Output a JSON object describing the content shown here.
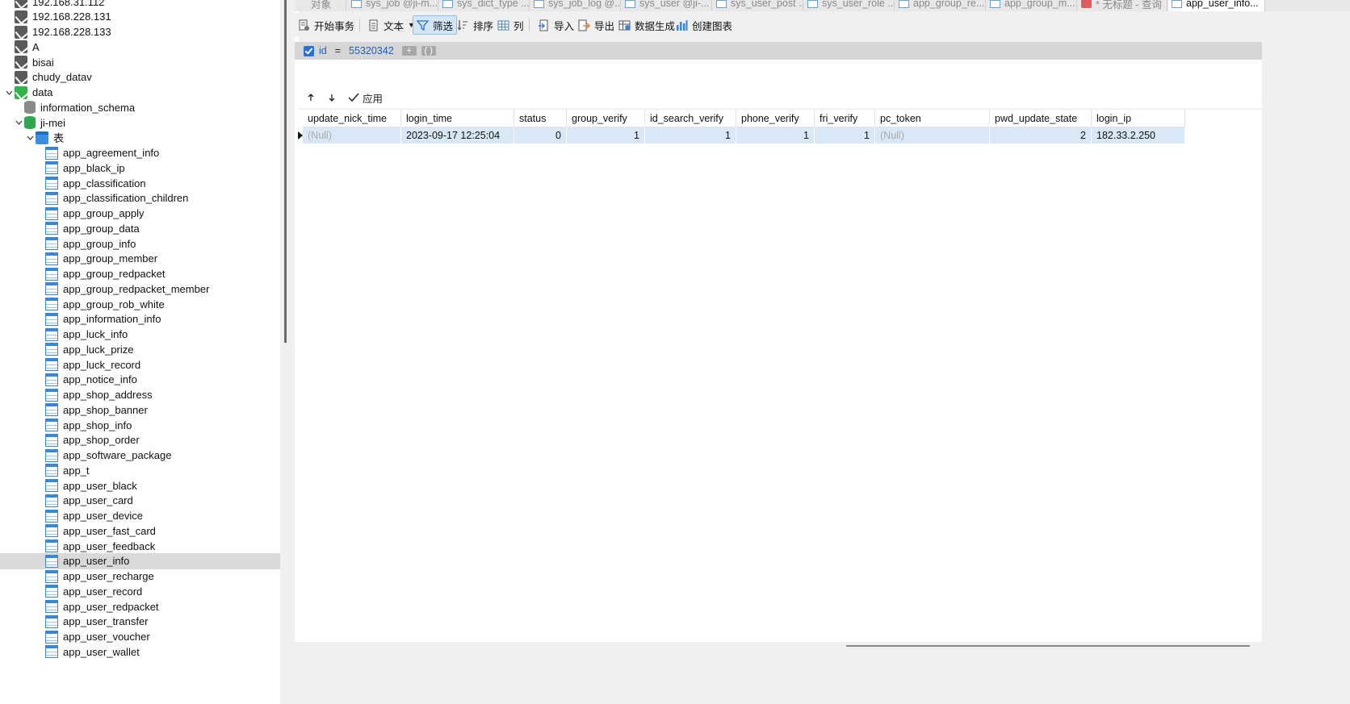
{
  "sidebar": {
    "items": [
      {
        "label": "192.168.31.112",
        "icon": "connection-icon",
        "level": 1,
        "chev": ""
      },
      {
        "label": "192.168.228.131",
        "icon": "connection-icon",
        "level": 1,
        "chev": ""
      },
      {
        "label": "192.168.228.133",
        "icon": "connection-icon",
        "level": 1,
        "chev": ""
      },
      {
        "label": "A",
        "icon": "connection-icon",
        "level": 1,
        "chev": ""
      },
      {
        "label": "bisai",
        "icon": "connection-icon",
        "level": 1,
        "chev": ""
      },
      {
        "label": "chudy_datav",
        "icon": "connection-icon",
        "level": 1,
        "chev": ""
      },
      {
        "label": "data",
        "icon": "connection-green-icon",
        "level": 1,
        "chev": "v"
      },
      {
        "label": "information_schema",
        "icon": "database-icon",
        "level": 2,
        "chev": ""
      },
      {
        "label": "ji-mei",
        "icon": "database-green-icon",
        "level": 2,
        "chev": "v"
      },
      {
        "label": "表",
        "icon": "folder-icon",
        "level": 3,
        "chev": "v"
      },
      {
        "label": "app_agreement_info",
        "icon": "table-icon",
        "level": 4,
        "chev": ""
      },
      {
        "label": "app_black_ip",
        "icon": "table-icon",
        "level": 4,
        "chev": ""
      },
      {
        "label": "app_classification",
        "icon": "table-icon",
        "level": 4,
        "chev": ""
      },
      {
        "label": "app_classification_children",
        "icon": "table-icon",
        "level": 4,
        "chev": ""
      },
      {
        "label": "app_group_apply",
        "icon": "table-icon",
        "level": 4,
        "chev": ""
      },
      {
        "label": "app_group_data",
        "icon": "table-icon",
        "level": 4,
        "chev": ""
      },
      {
        "label": "app_group_info",
        "icon": "table-icon",
        "level": 4,
        "chev": ""
      },
      {
        "label": "app_group_member",
        "icon": "table-icon",
        "level": 4,
        "chev": ""
      },
      {
        "label": "app_group_redpacket",
        "icon": "table-icon",
        "level": 4,
        "chev": ""
      },
      {
        "label": "app_group_redpacket_member",
        "icon": "table-icon",
        "level": 4,
        "chev": ""
      },
      {
        "label": "app_group_rob_white",
        "icon": "table-icon",
        "level": 4,
        "chev": ""
      },
      {
        "label": "app_information_info",
        "icon": "table-icon",
        "level": 4,
        "chev": ""
      },
      {
        "label": "app_luck_info",
        "icon": "table-icon",
        "level": 4,
        "chev": ""
      },
      {
        "label": "app_luck_prize",
        "icon": "table-icon",
        "level": 4,
        "chev": ""
      },
      {
        "label": "app_luck_record",
        "icon": "table-icon",
        "level": 4,
        "chev": ""
      },
      {
        "label": "app_notice_info",
        "icon": "table-icon",
        "level": 4,
        "chev": ""
      },
      {
        "label": "app_shop_address",
        "icon": "table-icon",
        "level": 4,
        "chev": ""
      },
      {
        "label": "app_shop_banner",
        "icon": "table-icon",
        "level": 4,
        "chev": ""
      },
      {
        "label": "app_shop_info",
        "icon": "table-icon",
        "level": 4,
        "chev": ""
      },
      {
        "label": "app_shop_order",
        "icon": "table-icon",
        "level": 4,
        "chev": ""
      },
      {
        "label": "app_software_package",
        "icon": "table-icon",
        "level": 4,
        "chev": ""
      },
      {
        "label": "app_t",
        "icon": "table-icon",
        "level": 4,
        "chev": ""
      },
      {
        "label": "app_user_black",
        "icon": "table-icon",
        "level": 4,
        "chev": ""
      },
      {
        "label": "app_user_card",
        "icon": "table-icon",
        "level": 4,
        "chev": ""
      },
      {
        "label": "app_user_device",
        "icon": "table-icon",
        "level": 4,
        "chev": ""
      },
      {
        "label": "app_user_fast_card",
        "icon": "table-icon",
        "level": 4,
        "chev": ""
      },
      {
        "label": "app_user_feedback",
        "icon": "table-icon",
        "level": 4,
        "chev": ""
      },
      {
        "label": "app_user_info",
        "icon": "table-icon",
        "level": 4,
        "chev": "",
        "selected": true
      },
      {
        "label": "app_user_recharge",
        "icon": "table-icon",
        "level": 4,
        "chev": ""
      },
      {
        "label": "app_user_record",
        "icon": "table-icon",
        "level": 4,
        "chev": ""
      },
      {
        "label": "app_user_redpacket",
        "icon": "table-icon",
        "level": 4,
        "chev": ""
      },
      {
        "label": "app_user_transfer",
        "icon": "table-icon",
        "level": 4,
        "chev": ""
      },
      {
        "label": "app_user_voucher",
        "icon": "table-icon",
        "level": 4,
        "chev": ""
      },
      {
        "label": "app_user_wallet",
        "icon": "table-icon",
        "level": 4,
        "chev": ""
      }
    ]
  },
  "tabs": [
    {
      "label": "对象",
      "icon": ""
    },
    {
      "label": "sys_job @ji-m...",
      "icon": "table-icon"
    },
    {
      "label": "sys_dict_type ...",
      "icon": "table-icon"
    },
    {
      "label": "sys_job_log @...",
      "icon": "table-icon"
    },
    {
      "label": "sys_user @ji-...",
      "icon": "table-icon"
    },
    {
      "label": "sys_user_post ...",
      "icon": "table-icon"
    },
    {
      "label": "sys_user_role ...",
      "icon": "table-icon"
    },
    {
      "label": "app_group_re...",
      "icon": "table-icon"
    },
    {
      "label": "app_group_m...",
      "icon": "table-icon"
    },
    {
      "label": "* 无标题 - 查询",
      "icon": "query-icon"
    },
    {
      "label": "app_user_info...",
      "icon": "table-icon",
      "active": true
    }
  ],
  "toolbar": {
    "begin_transaction": "开始事务",
    "text": "文本",
    "filter": "筛选",
    "sort": "排序",
    "columns": "列",
    "import": "导入",
    "export": "导出",
    "data_generation": "数据生成",
    "create_chart": "创建图表"
  },
  "filter": {
    "field": "id",
    "operator": "=",
    "value": "55320342",
    "apply": "应用"
  },
  "grid": {
    "columns": [
      "update_nick_time",
      "login_time",
      "status",
      "group_verify",
      "id_search_verify",
      "phone_verify",
      "fri_verify",
      "pc_token",
      "pwd_update_state",
      "login_ip"
    ],
    "rows": [
      [
        "(Null)",
        "2023-09-17 12:25:04",
        "0",
        "1",
        "1",
        "1",
        "1",
        "(Null)",
        "2",
        "182.33.2.250"
      ]
    ]
  },
  "colors": {
    "selection": "#d9e8f7",
    "filter_blue": "#1f5fbf",
    "active_button": "#d3e5f7"
  }
}
